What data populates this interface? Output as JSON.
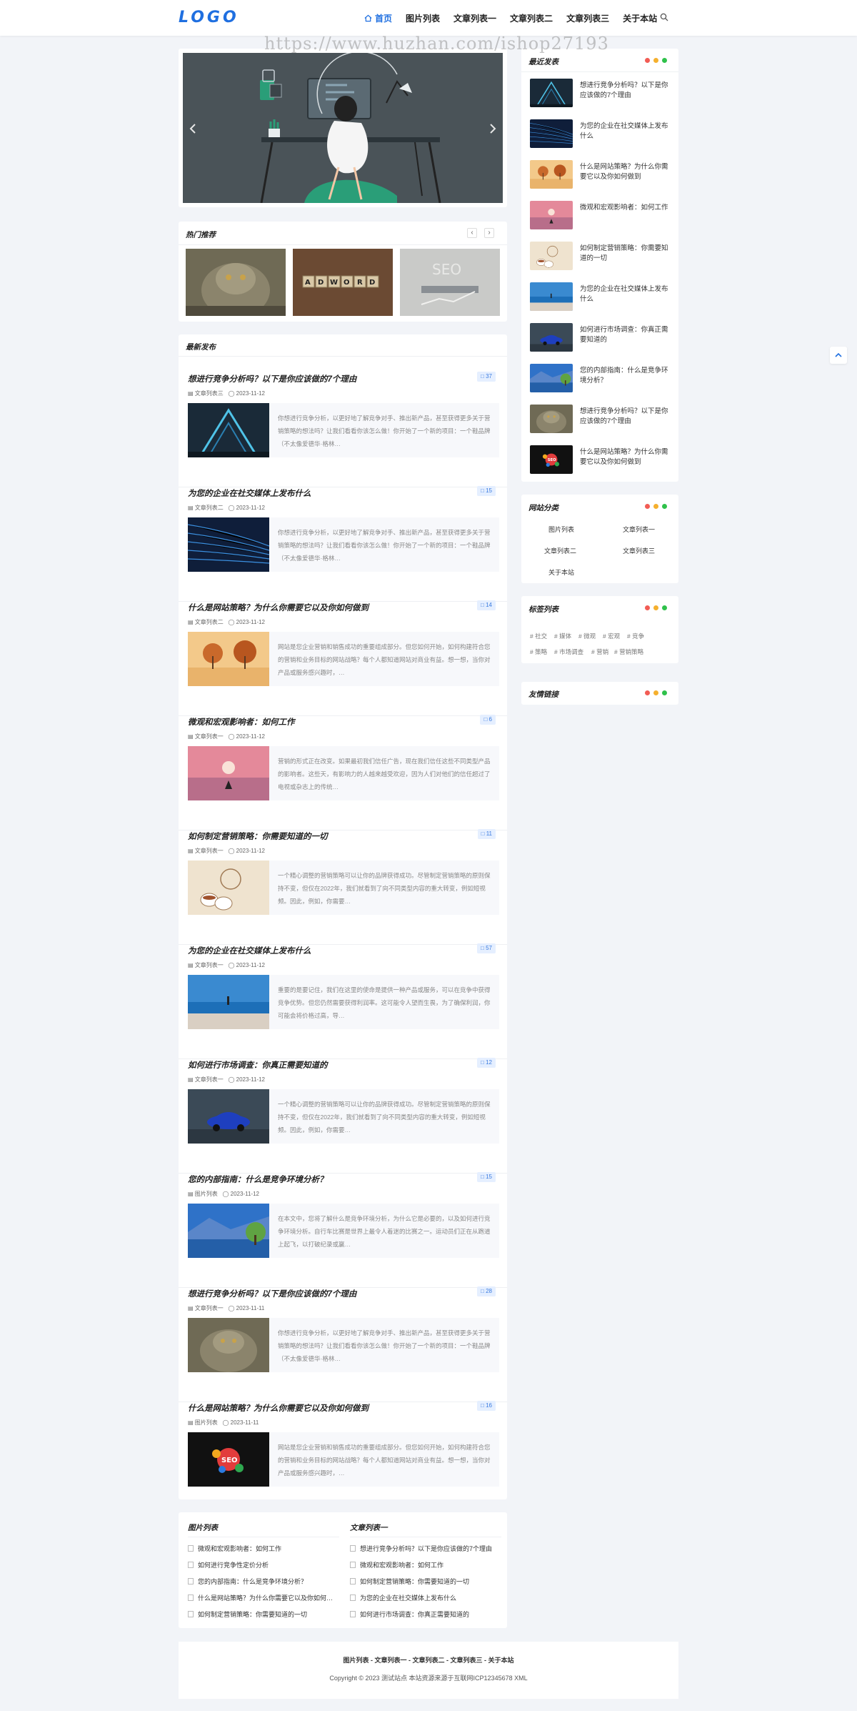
{
  "header": {
    "logo": "LOGO",
    "nav": [
      {
        "label": "首页",
        "active": true
      },
      {
        "label": "图片列表"
      },
      {
        "label": "文章列表一"
      },
      {
        "label": "文章列表二"
      },
      {
        "label": "文章列表三"
      },
      {
        "label": "关于本站"
      }
    ],
    "search_icon": "search-icon",
    "home_icon": "home-icon"
  },
  "watermark": "https://www.huzhan.com/ishop27193",
  "slider": {
    "prev_icon": "chevron-left-icon",
    "next_icon": "chevron-right-icon"
  },
  "hot": {
    "title": "热门推荐",
    "prev": "‹",
    "next": "›"
  },
  "latest": {
    "title": "最新发布",
    "posts": [
      {
        "title": "想进行竞争分析吗？以下是你应该做的7个理由",
        "comments": "37",
        "category": "文章列表三",
        "date": "2023-11-12",
        "excerpt": "你想进行竞争分析，以更好地了解竞争对手、推出新产品，甚至获得更多关于营销策略的想法吗？让我们看看你该怎么做！你开始了一个新的项目：一个鞋品牌（不太像爱德华·格林…"
      },
      {
        "title": "为您的企业在社交媒体上发布什么",
        "comments": "15",
        "category": "文章列表二",
        "date": "2023-11-12",
        "excerpt": "你想进行竞争分析，以更好地了解竞争对手、推出新产品，甚至获得更多关于营销策略的想法吗？让我们看看你该怎么做！你开始了一个新的项目：一个鞋品牌（不太像爱德华·格林…"
      },
      {
        "title": "什么是网站策略？为什么你需要它以及你如何做到",
        "comments": "14",
        "category": "文章列表二",
        "date": "2023-11-12",
        "excerpt": "网站是您企业营销和销售成功的重要组成部分。但您如何开始，如何构建符合您的营销和业务目标的网站战略？每个人都知道网站对商业有益。想一想，当你对产品或服务感兴趣时，…"
      },
      {
        "title": "微观和宏观影响者：如何工作",
        "comments": "6",
        "category": "文章列表一",
        "date": "2023-11-12",
        "excerpt": "营销的形式正在改变。如果最初我们信任广告，现在我们信任这些不同类型产品的影响者。这些天，有影响力的人越来越受欢迎，因为人们对他们的信任超过了电视或杂志上的传统…"
      },
      {
        "title": "如何制定营销策略：你需要知道的一切",
        "comments": "11",
        "category": "文章列表一",
        "date": "2023-11-12",
        "excerpt": "一个精心调整的营销策略可以让你的品牌获得成功。尽管制定营销策略的原则保持不变，但仅在2022年，我们就看到了向不同类型内容的重大转变，例如短视频。因此，例如，你需要…"
      },
      {
        "title": "为您的企业在社交媒体上发布什么",
        "comments": "57",
        "category": "文章列表一",
        "date": "2023-11-12",
        "excerpt": "重要的是要记住，我们在这里的使命是提供一种产品或服务，可以在竞争中获得竞争优势。但您仍然需要获得利润率。这可能令人望而生畏，为了确保利润，你可能会将价格过高，导…"
      },
      {
        "title": "如何进行市场调查：你真正需要知道的",
        "comments": "12",
        "category": "文章列表一",
        "date": "2023-11-12",
        "excerpt": "一个精心调整的营销策略可以让你的品牌获得成功。尽管制定营销策略的原则保持不变，但仅在2022年，我们就看到了向不同类型内容的重大转变，例如短视频。因此，例如，你需要…"
      },
      {
        "title": "您的内部指南：什么是竞争环境分析？",
        "comments": "15",
        "category": "图片列表",
        "date": "2023-11-12",
        "excerpt": "在本文中，您将了解什么是竞争环境分析，为什么它是必要的，以及如何进行竞争环境分析。自行车比赛是世界上最令人着迷的比赛之一。运动员们正在从跑道上起飞，以打破纪录或赢…"
      },
      {
        "title": "想进行竞争分析吗？以下是你应该做的7个理由",
        "comments": "28",
        "category": "文章列表一",
        "date": "2023-11-11",
        "excerpt": "你想进行竞争分析，以更好地了解竞争对手、推出新产品，甚至获得更多关于营销策略的想法吗？让我们看看你该怎么做！你开始了一个新的项目：一个鞋品牌（不太像爱德华·格林…"
      },
      {
        "title": "什么是网站策略？为什么你需要它以及你如何做到",
        "comments": "16",
        "category": "图片列表",
        "date": "2023-11-11",
        "excerpt": "网站是您企业营销和销售成功的重要组成部分。但您如何开始，如何构建符合您的营销和业务目标的网站战略？每个人都知道网站对商业有益。想一想，当你对产品或服务感兴趣时，…"
      }
    ]
  },
  "bottom_lists": [
    {
      "title": "图片列表",
      "items": [
        "微观和宏观影响者：如何工作",
        "如何进行竞争性定价分析",
        "您的内部指南：什么是竞争环境分析？",
        "什么是网站策略？为什么你需要它以及你如何…",
        "如何制定营销策略：你需要知道的一切"
      ]
    },
    {
      "title": "文章列表一",
      "items": [
        "想进行竞争分析吗？以下是你应该做的7个理由",
        "微观和宏观影响者：如何工作",
        "如何制定营销策略：你需要知道的一切",
        "为您的企业在社交媒体上发布什么",
        "如何进行市场调查：你真正需要知道的"
      ]
    }
  ],
  "sidebar": {
    "recent_title": "最近发表",
    "recent": [
      "想进行竞争分析吗？以下是你应该做的7个理由",
      "为您的企业在社交媒体上发布什么",
      "什么是网站策略？为什么你需要它以及你如何做到",
      "微观和宏观影响者：如何工作",
      "如何制定营销策略：你需要知道的一切",
      "为您的企业在社交媒体上发布什么",
      "如何进行市场调查：你真正需要知道的",
      "您的内部指南：什么是竞争环境分析？",
      "想进行竞争分析吗？以下是你应该做的7个理由",
      "什么是网站策略？为什么你需要它以及你如何做到"
    ],
    "cat_title": "网站分类",
    "categories": [
      "图片列表",
      "文章列表一",
      "文章列表二",
      "文章列表三",
      "关于本站"
    ],
    "tag_title": "标签列表",
    "tags": [
      "# 社交",
      "# 媒体",
      "# 微观",
      "# 宏观",
      "# 竞争",
      "# 策略",
      "# 市场调查",
      "# 营销",
      "# 营销策略"
    ],
    "links_title": "友情链接"
  },
  "footer": {
    "links": "图片列表 - 文章列表一 - 文章列表二 - 文章列表三 - 关于本站",
    "copyright": "Copyright © 2023 测试站点 本站资源来源于互联网ICP12345678 XML"
  },
  "colors": {
    "accent": "#1f6fe0",
    "dot_red": "#f25c54",
    "dot_yellow": "#f5b02e",
    "dot_green": "#2fc14b"
  }
}
